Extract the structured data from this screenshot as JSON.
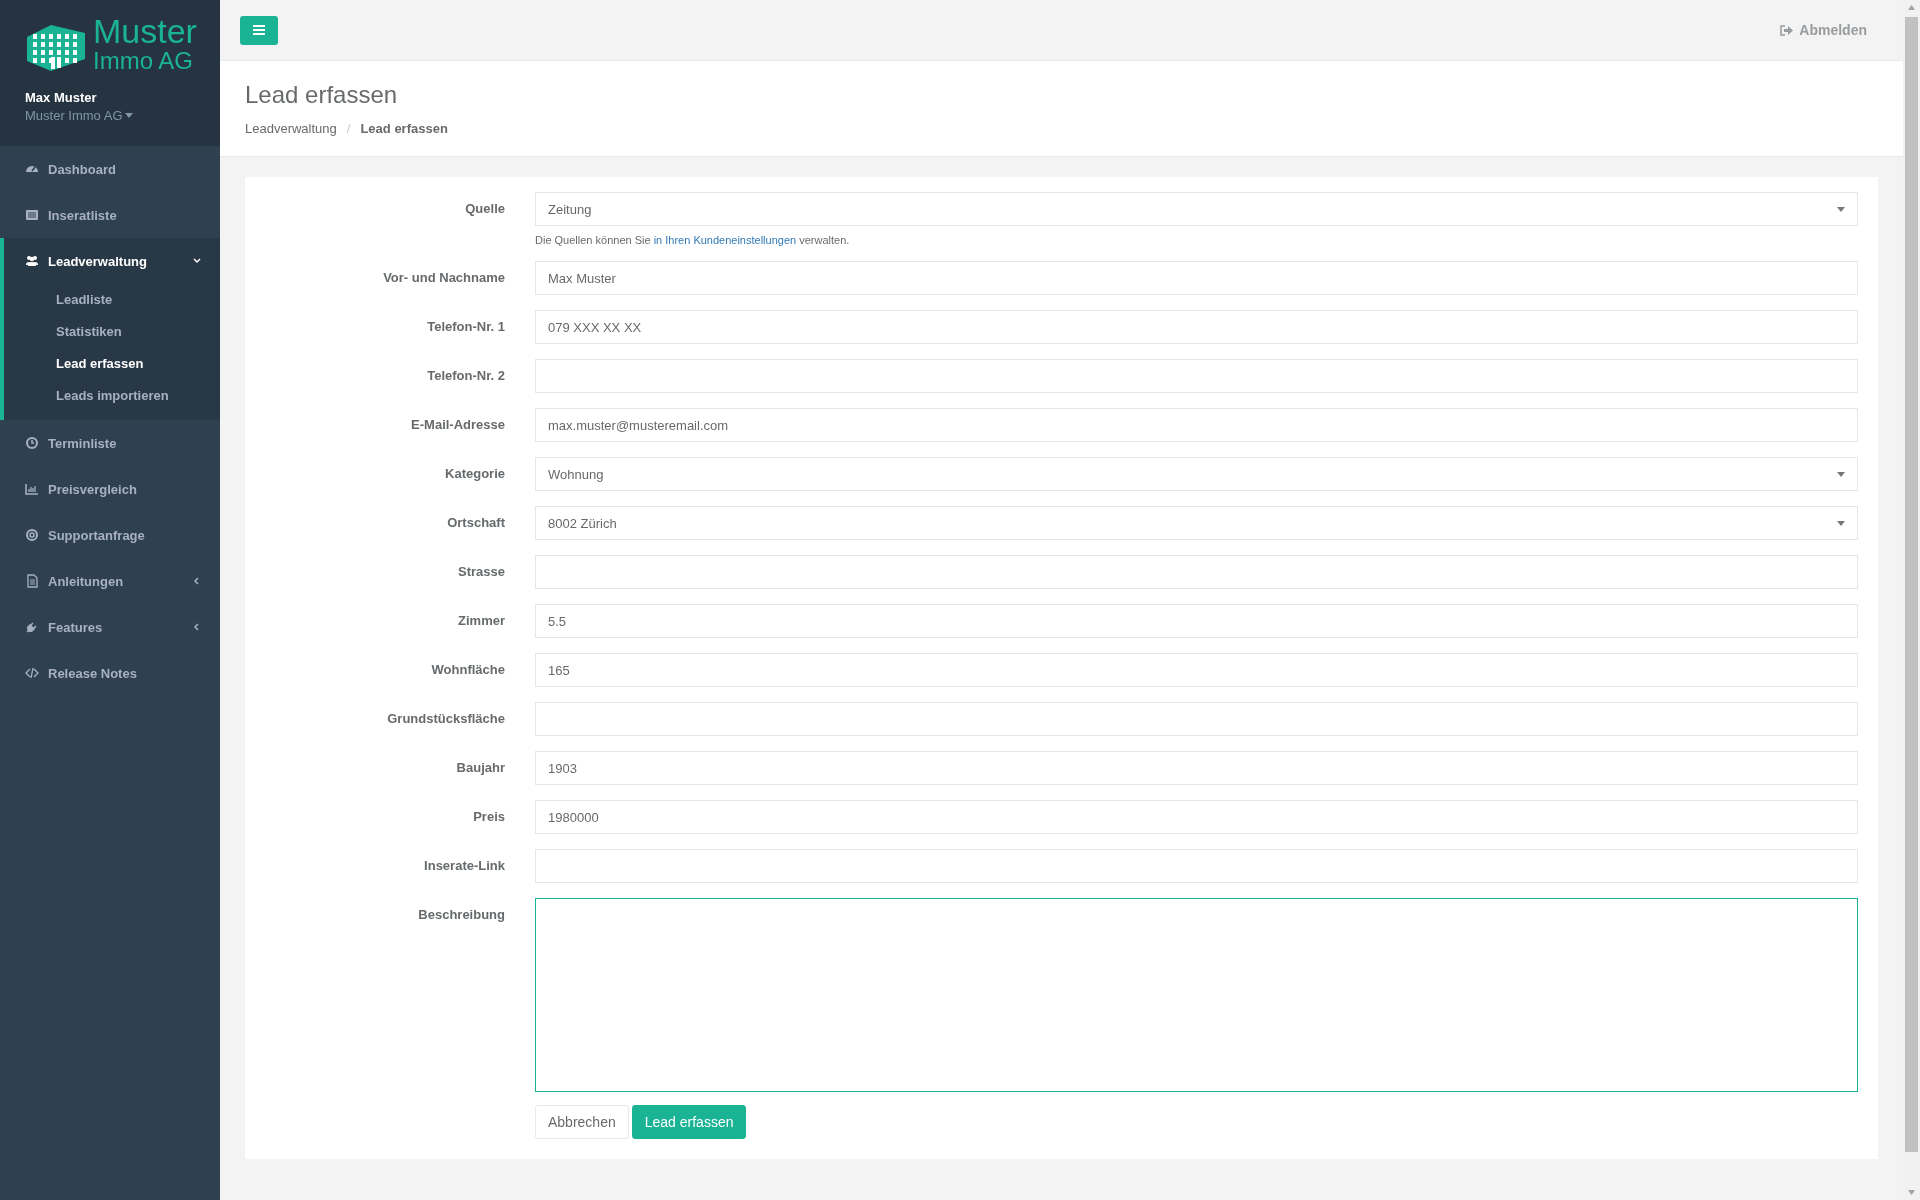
{
  "sidebar": {
    "logo": {
      "line_1": "Muster",
      "line_2": "Immo AG"
    },
    "user": {
      "name": "Max Muster",
      "company": "Muster Immo AG"
    },
    "items": [
      {
        "label": "Dashboard",
        "selected": false
      },
      {
        "label": "Inseratliste",
        "selected": false
      },
      {
        "label": "Leadverwaltung",
        "selected": true,
        "expanded": true,
        "children": [
          {
            "label": "Leadliste",
            "selected": false
          },
          {
            "label": "Statistiken",
            "selected": false
          },
          {
            "label": "Lead erfassen",
            "selected": true
          },
          {
            "label": "Leads importieren",
            "selected": false
          }
        ]
      },
      {
        "label": "Terminliste",
        "selected": false
      },
      {
        "label": "Preisvergleich",
        "selected": false
      },
      {
        "label": "Supportanfrage",
        "selected": false
      },
      {
        "label": "Anleitungen",
        "selected": false,
        "expanded": false
      },
      {
        "label": "Features",
        "selected": false,
        "expanded": false
      },
      {
        "label": "Release Notes",
        "selected": false
      }
    ]
  },
  "topbar": {
    "logout": "Abmelden"
  },
  "page": {
    "title": "Lead erfassen",
    "breadcrumb_separator": "/",
    "breadcrumb": [
      {
        "label": "Leadverwaltung",
        "selected": false
      },
      {
        "label": "Lead erfassen",
        "selected": true
      }
    ]
  },
  "form": {
    "fields": [
      {
        "kind": "select",
        "label": "Quelle",
        "value": "Zeitung",
        "help": {
          "before": "Die Quellen können Sie",
          "link": "in Ihren Kundeneinstellungen",
          "after": "verwalten."
        }
      },
      {
        "kind": "text",
        "label": "Vor- und Nachname",
        "value": "Max Muster"
      },
      {
        "kind": "text",
        "label": "Telefon-Nr. 1",
        "value": "079 XXX XX XX"
      },
      {
        "kind": "text",
        "label": "Telefon-Nr. 2"
      },
      {
        "kind": "text",
        "label": "E-Mail-Adresse",
        "value": "max.muster@musteremail.com"
      },
      {
        "kind": "select",
        "label": "Kategorie",
        "value": "Wohnung"
      },
      {
        "kind": "select",
        "label": "Ortschaft",
        "value": "8002 Zürich"
      },
      {
        "kind": "text",
        "label": "Strasse"
      },
      {
        "kind": "text",
        "label": "Zimmer",
        "value": "5.5"
      },
      {
        "kind": "text",
        "label": "Wohnfläche",
        "value": "165"
      },
      {
        "kind": "text",
        "label": "Grundstücksfläche"
      },
      {
        "kind": "text",
        "label": "Baujahr",
        "value": "1903"
      },
      {
        "kind": "text",
        "label": "Preis",
        "value": "1980000"
      },
      {
        "kind": "text",
        "label": "Inserate-Link"
      },
      {
        "kind": "textarea",
        "label": "Beschreibung",
        "focused": true
      }
    ],
    "buttons": [
      {
        "label": "Abbrechen",
        "kind": "default"
      },
      {
        "label": "Lead erfassen",
        "kind": "primary"
      }
    ]
  }
}
